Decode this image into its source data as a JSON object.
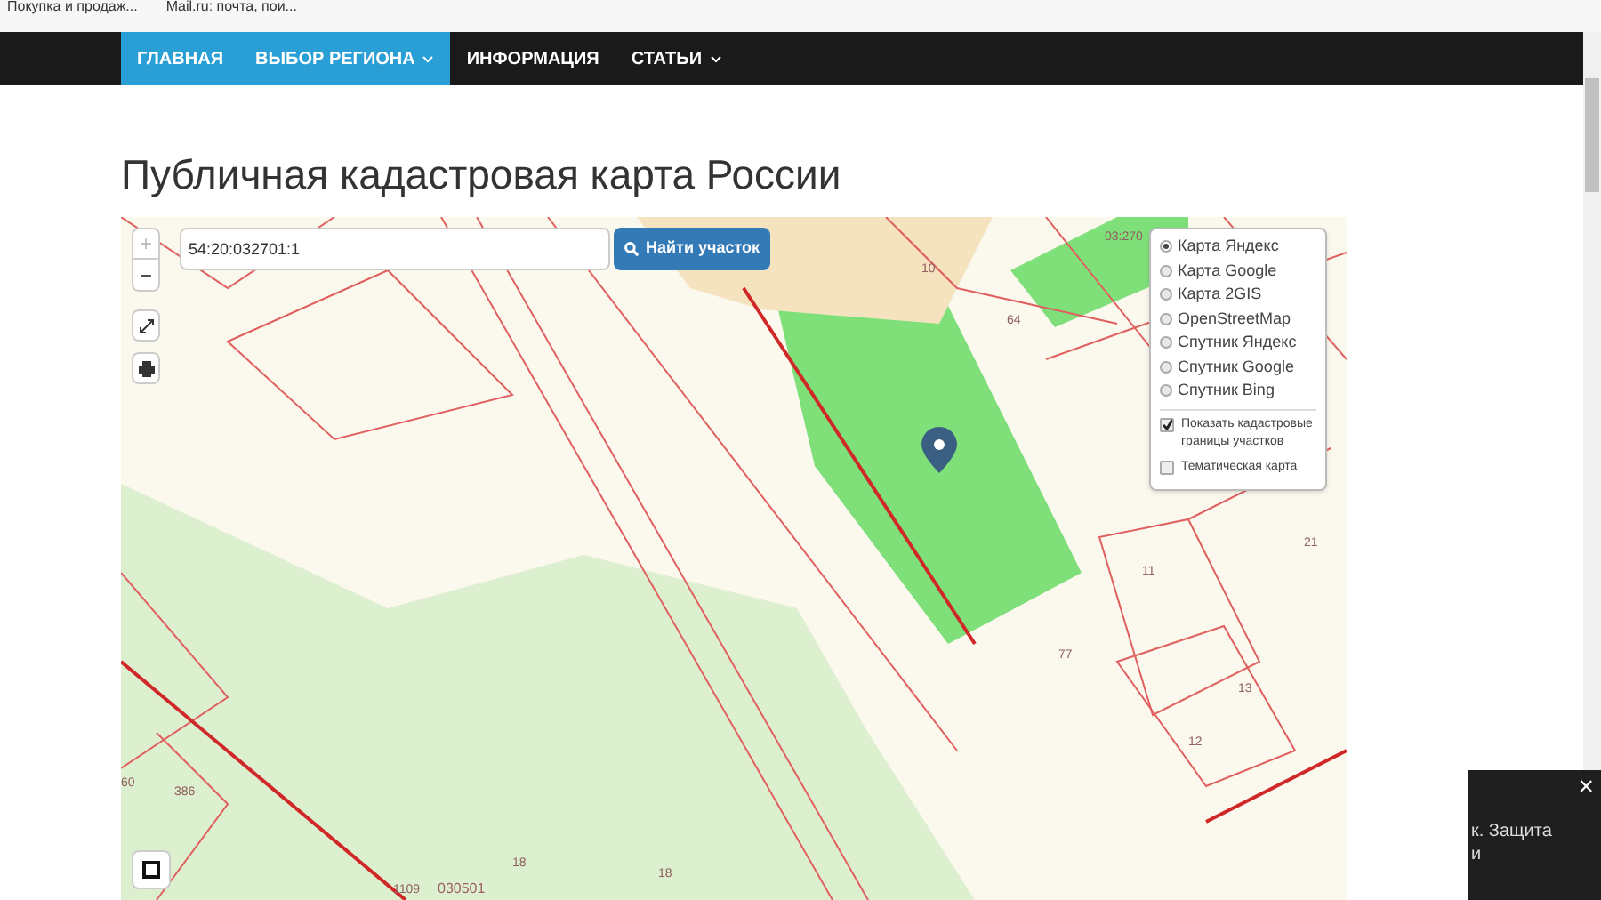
{
  "bookmarks": [
    {
      "label": "Покупка и продаж..."
    },
    {
      "label": "Mail.ru: почта, пои..."
    }
  ],
  "nav": [
    {
      "label": "ГЛАВНАЯ",
      "selected": true,
      "dropdown": false
    },
    {
      "label": "ВЫБОР РЕГИОНА",
      "selected": true,
      "dropdown": true
    },
    {
      "label": "ИНФОРМАЦИЯ",
      "selected": false,
      "dropdown": false
    },
    {
      "label": "СТАТЬИ",
      "selected": false,
      "dropdown": true
    }
  ],
  "title": "Публичная кадастровая карта России",
  "map": {
    "zoom_in": "+",
    "zoom_out": "−",
    "search": {
      "value": "54:20:032701:1",
      "button": "Найти участок"
    },
    "layers": [
      {
        "label": "Карта Яндекс",
        "selected": true
      },
      {
        "label": "Карта Google",
        "selected": false
      },
      {
        "label": "Карта 2GIS",
        "selected": false
      },
      {
        "label": "OpenStreetMap",
        "selected": false
      },
      {
        "label": "Спутник Яндекс",
        "selected": false
      },
      {
        "label": "Спутник Google",
        "selected": false
      },
      {
        "label": "Спутник Bing",
        "selected": false
      }
    ],
    "options": [
      {
        "label": "Показать кадастровые границы участков",
        "checked": true
      },
      {
        "label": "Тематическая карта",
        "checked": false
      }
    ],
    "labels": [
      "10",
      "64",
      "03:270",
      "11",
      "21",
      "77",
      "13",
      "12",
      "386",
      "60",
      "1109",
      "030501",
      "18",
      "18"
    ]
  },
  "toast": {
    "lines": [
      "к. Защита",
      "и"
    ],
    "close": "×"
  }
}
